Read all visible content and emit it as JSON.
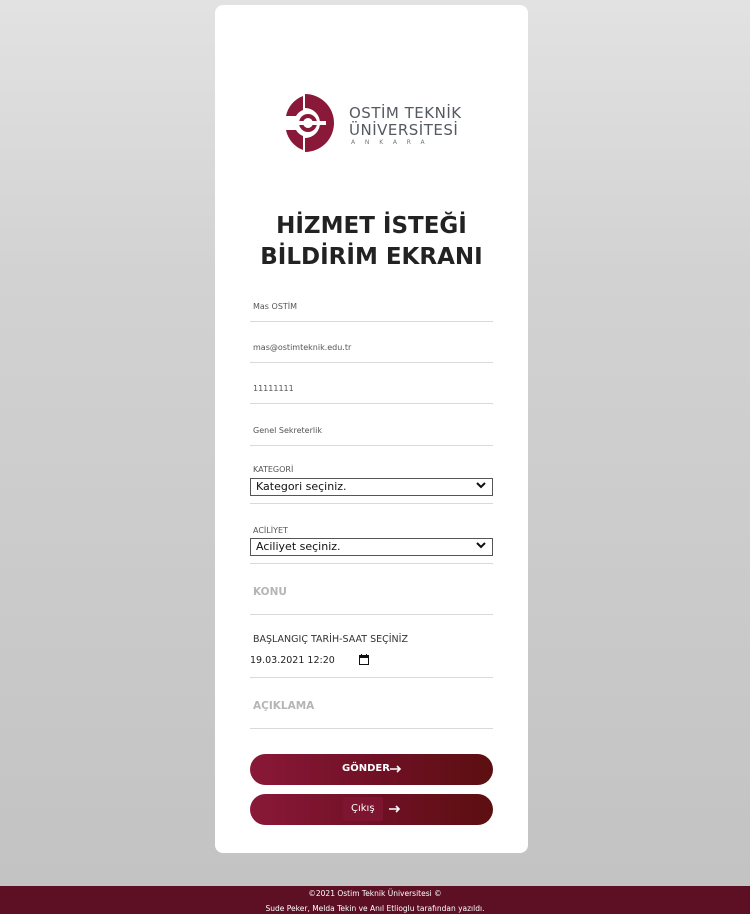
{
  "logo": {
    "line1": "OSTİM TEKNİK",
    "line2": "ÜNİVERSİTESİ",
    "line3": "ANKARA"
  },
  "title": {
    "line1": "HİZMET İSTEĞİ",
    "line2": "BİLDİRİM EKRANI"
  },
  "form": {
    "name": "Mas OSTİM",
    "email": "mas@ostimteknik.edu.tr",
    "phone": "11111111",
    "department": "Genel Sekreterlik",
    "category": {
      "label": "KATEGORİ",
      "selected": "Kategori seçiniz."
    },
    "urgency": {
      "label": "ACİLİYET",
      "selected": "Aciliyet seçiniz."
    },
    "subject_placeholder": "KONU",
    "datetime": {
      "label": "BAŞLANGIÇ TARİH-SAAT SEÇİNİZ",
      "value": "19.03.2021 12:20"
    },
    "description_placeholder": "AÇIKLAMA"
  },
  "buttons": {
    "submit": "GÖNDER",
    "exit": "Çıkış"
  },
  "footer": {
    "line1": "©2021 Ostim Teknik Üniversitesi ©",
    "line2": "Sude Peker, Melda Tekin ve Anıl Etlioglu tarafından yazıldı."
  },
  "colors": {
    "brand": "#8a1838",
    "brand_dark": "#5c0f10",
    "footer_bg": "#5d0f24"
  },
  "icons": {
    "chevron": "chevron-down-icon",
    "arrow": "arrow-right-icon",
    "calendar": "calendar-icon"
  }
}
